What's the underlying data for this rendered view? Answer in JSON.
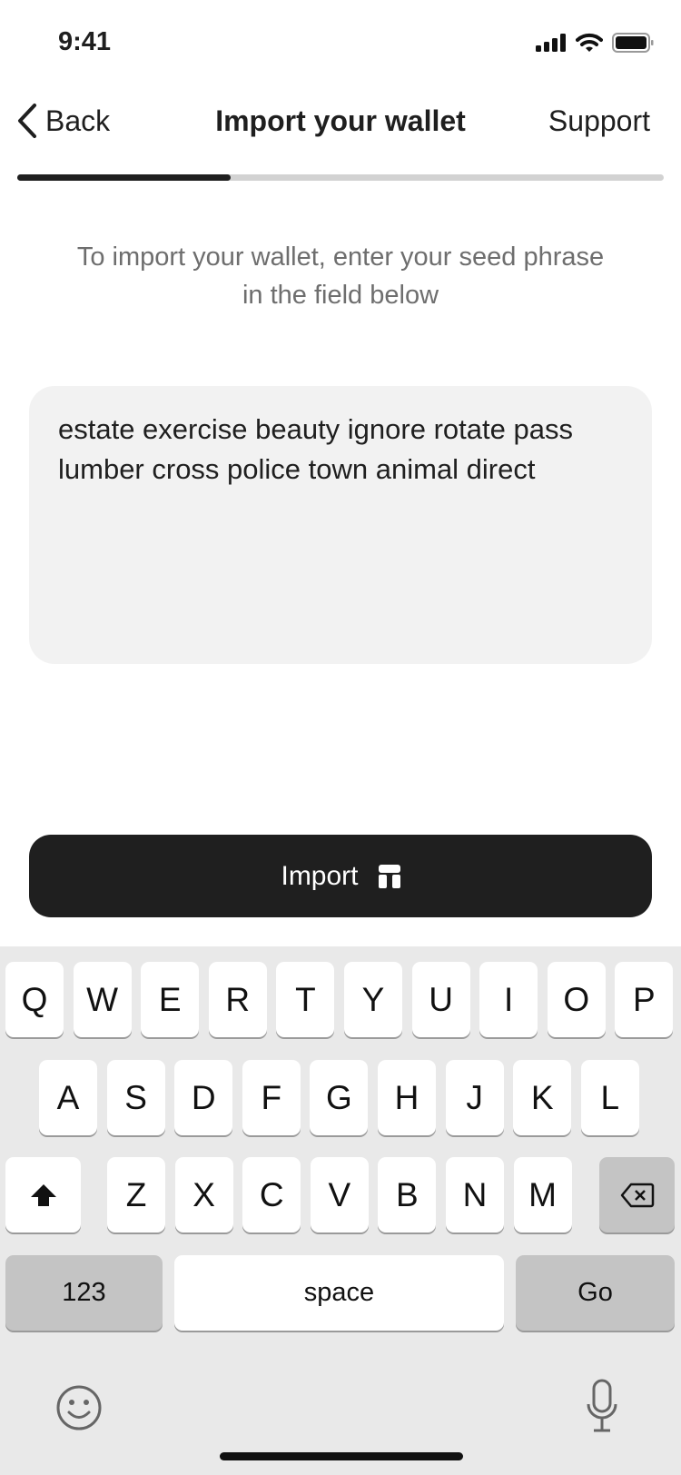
{
  "status_bar": {
    "time": "9:41",
    "icons": [
      "signal-icon",
      "wifi-icon",
      "battery-icon"
    ]
  },
  "nav": {
    "back_label": "Back",
    "title": "Import your wallet",
    "support_label": "Support"
  },
  "progress": {
    "value": 0.33
  },
  "subtitle": "To import your wallet, enter your seed phrase in the field below",
  "seed_input": {
    "value": "estate exercise beauty ignore rotate pass lumber cross police town animal direct"
  },
  "import_button": {
    "label": "Import",
    "icon": "import-icon"
  },
  "keyboard": {
    "row1": [
      "Q",
      "W",
      "E",
      "R",
      "T",
      "Y",
      "U",
      "I",
      "O",
      "P"
    ],
    "row2": [
      "A",
      "S",
      "D",
      "F",
      "G",
      "H",
      "J",
      "K",
      "L"
    ],
    "row3": [
      "Z",
      "X",
      "C",
      "V",
      "B",
      "N",
      "M"
    ],
    "numbers_label": "123",
    "space_label": "space",
    "go_label": "Go"
  },
  "colors": {
    "accent": "#1f1f1f",
    "field_bg": "#f2f2f2",
    "keyboard_bg": "#e9e9e9"
  }
}
